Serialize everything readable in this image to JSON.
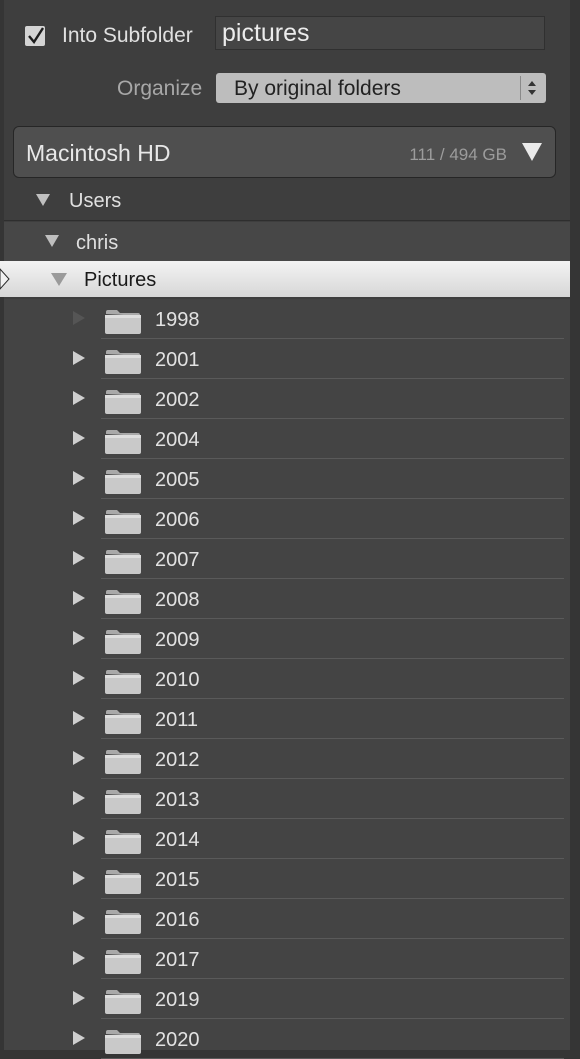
{
  "import_options": {
    "into_subfolder_checked": true,
    "into_subfolder_label": "Into Subfolder",
    "subfolder_name": "pictures",
    "organize_label": "Organize",
    "organize_value": "By original folders"
  },
  "volume": {
    "name": "Macintosh HD",
    "size": "111 / 494 GB"
  },
  "tree": {
    "users": "Users",
    "chris": "chris",
    "pictures": "Pictures"
  },
  "folders": [
    {
      "name": "1998",
      "expandable": false
    },
    {
      "name": "2001",
      "expandable": true
    },
    {
      "name": "2002",
      "expandable": true
    },
    {
      "name": "2004",
      "expandable": true
    },
    {
      "name": "2005",
      "expandable": true
    },
    {
      "name": "2006",
      "expandable": true
    },
    {
      "name": "2007",
      "expandable": true
    },
    {
      "name": "2008",
      "expandable": true
    },
    {
      "name": "2009",
      "expandable": true
    },
    {
      "name": "2010",
      "expandable": true
    },
    {
      "name": "2011",
      "expandable": true
    },
    {
      "name": "2012",
      "expandable": true
    },
    {
      "name": "2013",
      "expandable": true
    },
    {
      "name": "2014",
      "expandable": true
    },
    {
      "name": "2015",
      "expandable": true
    },
    {
      "name": "2016",
      "expandable": true
    },
    {
      "name": "2017",
      "expandable": true
    },
    {
      "name": "2019",
      "expandable": true
    },
    {
      "name": "2020",
      "expandable": true
    }
  ]
}
